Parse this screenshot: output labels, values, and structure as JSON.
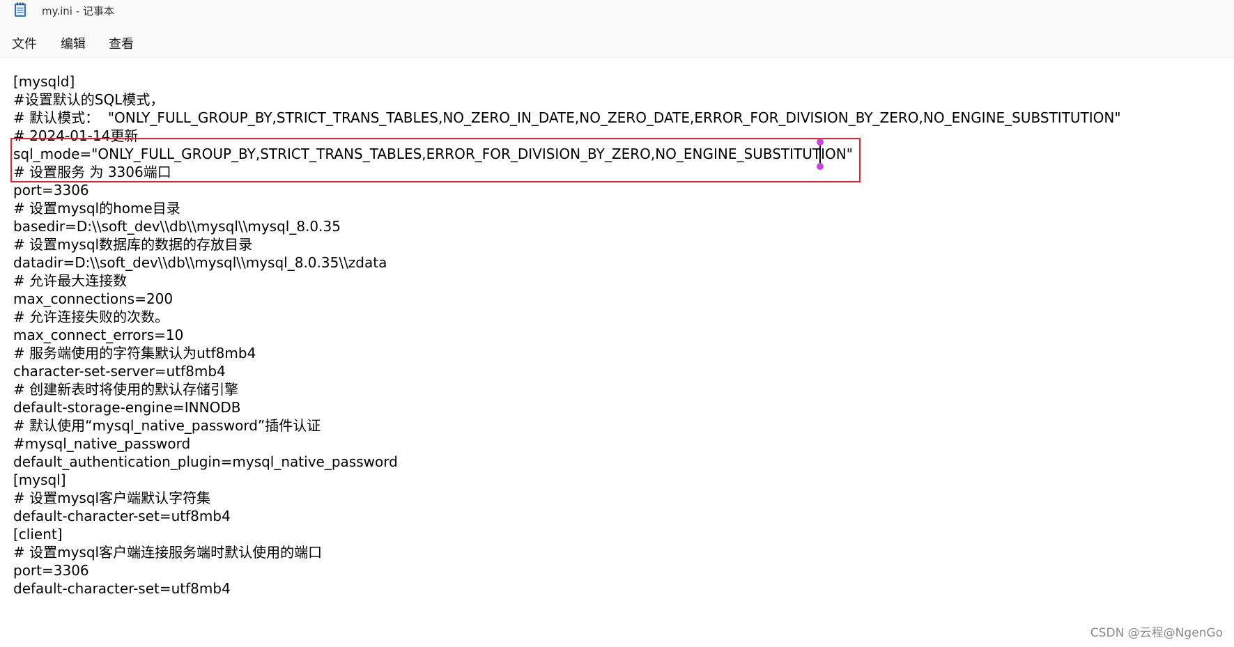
{
  "window": {
    "title": "my.ini - 记事本",
    "icon": "notepad-icon"
  },
  "menubar": {
    "file": "文件",
    "edit": "编辑",
    "view": "查看"
  },
  "editor": {
    "lines": [
      "[mysqld]",
      "#设置默认的SQL模式，",
      "# 默认模式：  \"ONLY_FULL_GROUP_BY,STRICT_TRANS_TABLES,NO_ZERO_IN_DATE,NO_ZERO_DATE,ERROR_FOR_DIVISION_BY_ZERO,NO_ENGINE_SUBSTITUTION\"",
      "# 2024-01-14更新",
      "sql_mode=\"ONLY_FULL_GROUP_BY,STRICT_TRANS_TABLES,ERROR_FOR_DIVISION_BY_ZERO,NO_ENGINE_SUBSTITUTION\"",
      "# 设置服务 为 3306端口",
      "port=3306",
      "# 设置mysql的home目录",
      "basedir=D:\\\\soft_dev\\\\db\\\\mysql\\\\mysql_8.0.35",
      "# 设置mysql数据库的数据的存放目录",
      "datadir=D:\\\\soft_dev\\\\db\\\\mysql\\\\mysql_8.0.35\\\\zdata",
      "# 允许最大连接数",
      "max_connections=200",
      "# 允许连接失败的次数。",
      "max_connect_errors=10",
      "# 服务端使用的字符集默认为utf8mb4",
      "character-set-server=utf8mb4",
      "# 创建新表时将使用的默认存储引擎",
      "default-storage-engine=INNODB",
      "# 默认使用“mysql_native_password”插件认证",
      "#mysql_native_password",
      "default_authentication_plugin=mysql_native_password",
      "[mysql]",
      "# 设置mysql客户端默认字符集",
      "default-character-set=utf8mb4",
      "[client]",
      "# 设置mysql客户端连接服务端时默认使用的端口",
      "port=3306",
      "default-character-set=utf8mb4"
    ]
  },
  "colors": {
    "highlight_border": "#e02433",
    "selection_handle": "#c447e0"
  },
  "watermark": "CSDN @云程@NgenGo"
}
